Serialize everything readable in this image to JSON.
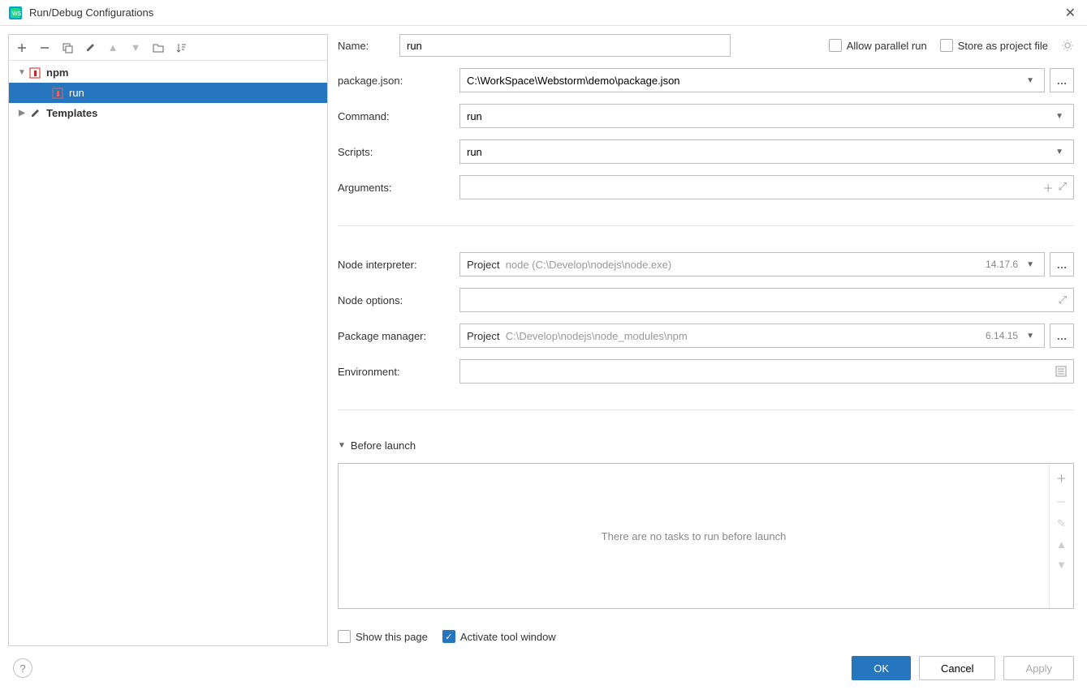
{
  "title": "Run/Debug Configurations",
  "tree": {
    "npm_label": "npm",
    "run_label": "run",
    "templates_label": "Templates"
  },
  "topRow": {
    "nameLabel": "Name:",
    "nameValue": "run",
    "allowParallel": "Allow parallel run",
    "storeAsProjectFile": "Store as project file"
  },
  "form": {
    "packageJson": {
      "label": "package.json:",
      "value": "C:\\WorkSpace\\Webstorm\\demo\\package.json"
    },
    "command": {
      "label": "Command:",
      "value": "run"
    },
    "scripts": {
      "label": "Scripts:",
      "value": "run"
    },
    "arguments": {
      "label": "Arguments:",
      "value": ""
    },
    "nodeInterpreter": {
      "label": "Node interpreter:",
      "prefix": "Project",
      "hint": "node (C:\\Develop\\nodejs\\node.exe)",
      "version": "14.17.6"
    },
    "nodeOptions": {
      "label": "Node options:",
      "value": ""
    },
    "packageManager": {
      "label": "Package manager:",
      "prefix": "Project",
      "hint": "C:\\Develop\\nodejs\\node_modules\\npm",
      "version": "6.14.15"
    },
    "environment": {
      "label": "Environment:",
      "value": ""
    }
  },
  "beforeLaunch": {
    "header": "Before launch",
    "empty": "There are no tasks to run before launch"
  },
  "footerChecks": {
    "showThisPage": "Show this page",
    "activateToolWindow": "Activate tool window"
  },
  "buttons": {
    "ok": "OK",
    "cancel": "Cancel",
    "apply": "Apply"
  }
}
